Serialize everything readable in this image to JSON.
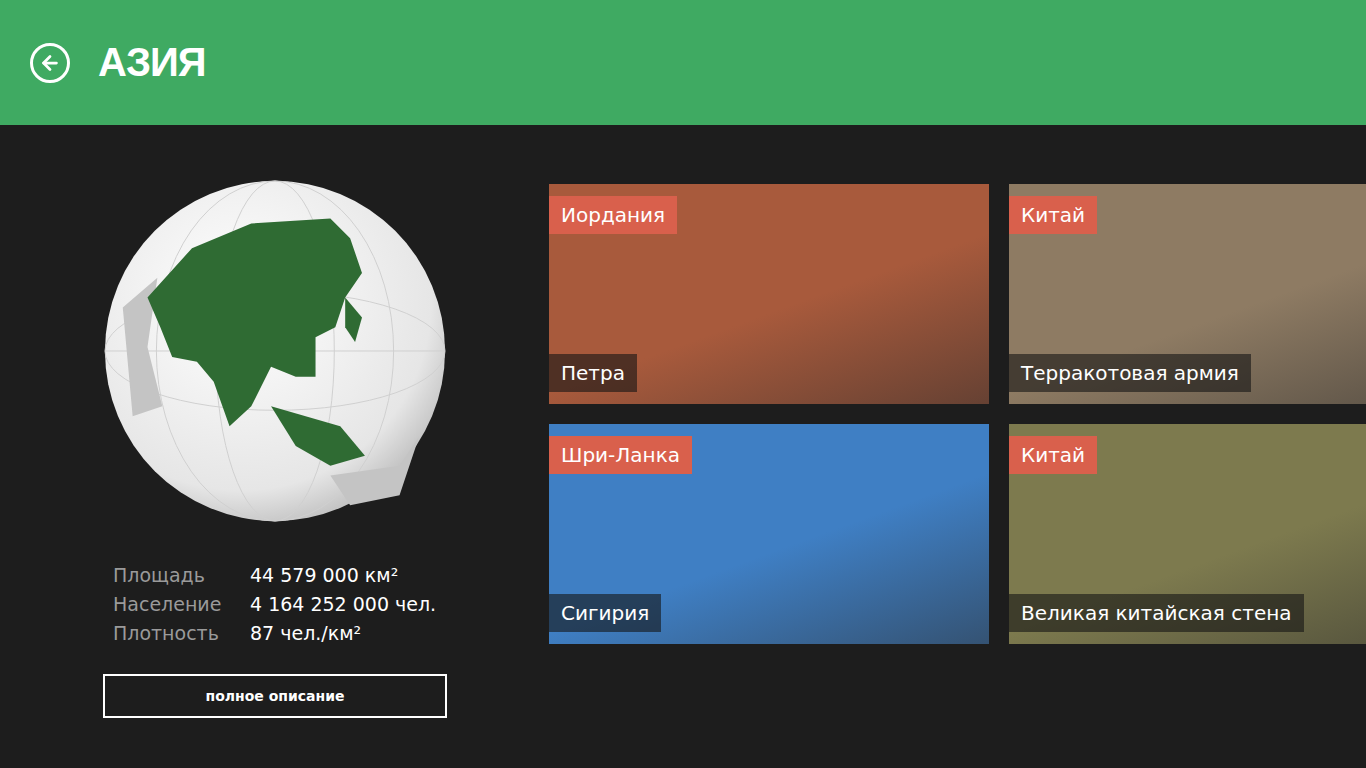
{
  "header": {
    "title": "АЗИЯ"
  },
  "stats": [
    {
      "label": "Площадь",
      "value": "44 579 000 км²"
    },
    {
      "label": "Население",
      "value": "4 164 252 000 чел."
    },
    {
      "label": "Плотность",
      "value": "87 чел./км²"
    }
  ],
  "button": {
    "label": "полное описание"
  },
  "tiles": [
    {
      "country": "Иордания",
      "name": "Петра",
      "color": "#a85a3c"
    },
    {
      "country": "Китай",
      "name": "Терракотовая армия",
      "color": "#8e7b63"
    },
    {
      "country": "Шри-Ланка",
      "name": "Сигирия",
      "color": "#3f7fc4"
    },
    {
      "country": "Китай",
      "name": "Великая китайская стена",
      "color": "#7d7a4e"
    }
  ]
}
